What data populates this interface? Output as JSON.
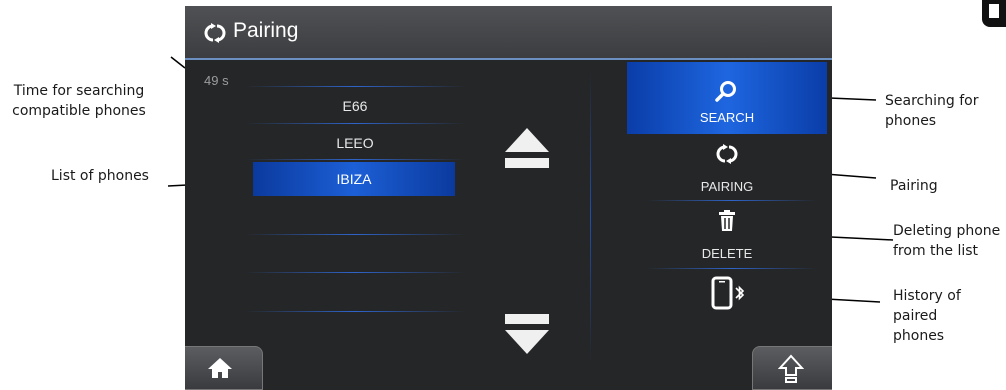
{
  "screen": {
    "title": "Pairing",
    "timer": "49 s",
    "phones": [
      "E66",
      "LEEO",
      "IBIZA"
    ],
    "selected_phone": "IBIZA",
    "actions": {
      "search": "SEARCH",
      "pairing": "PAIRING",
      "delete": "DELETE"
    }
  },
  "annotations": {
    "time_searching": "Time for searching compatible phones",
    "list_of_phones": "List of phones",
    "searching_for_phones": "Searching for phones",
    "pairing": "Pairing",
    "deleting_phone": "Deleting phone from the list",
    "history": "History of paired phones"
  },
  "colors": {
    "accent_blue": "#1e66e0",
    "screen_bg": "#252628",
    "titlebar": "#47484b"
  },
  "icons": [
    "pairing-icon",
    "search-icon",
    "trash-icon",
    "phone-bluetooth-icon",
    "home-icon",
    "up-arrow-icon",
    "down-arrow-icon"
  ]
}
